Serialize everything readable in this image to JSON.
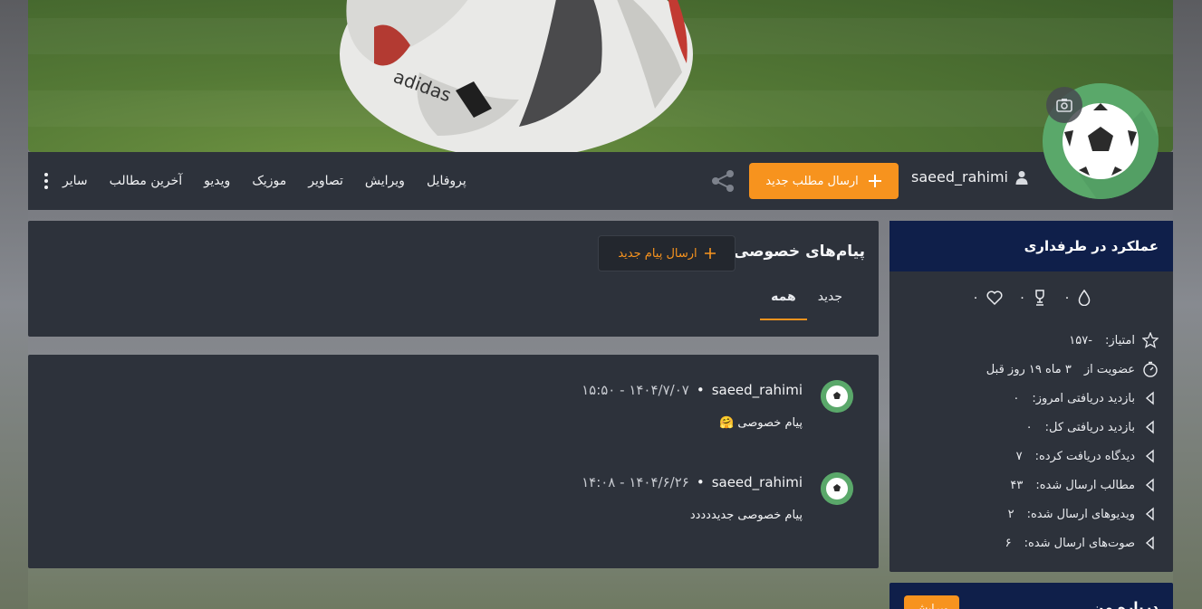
{
  "header": {
    "username": "saeed_rahimi",
    "new_post_label": "ارسال مطلب جدید",
    "menu": [
      "سایر",
      "آخرین مطالب",
      "ویدیو",
      "موزیک",
      "تصاویر",
      "ویرایش",
      "پروفایل"
    ]
  },
  "messages": {
    "title": "پیام‌های خصوصی",
    "send_label": "ارسال پیام جدید",
    "tabs": [
      {
        "label": "جدید",
        "active": false
      },
      {
        "label": "همه",
        "active": true
      }
    ],
    "items": [
      {
        "user": "saeed_rahimi",
        "time": "۱۴۰۴/۷/۰۷ - ۱۵:۵۰",
        "body": "پیام خصوصی 🤗"
      },
      {
        "user": "saeed_rahimi",
        "time": "۱۴۰۴/۶/۲۶ - ۱۴:۰۸",
        "body": "پیام خصوصی جدیددددد"
      }
    ]
  },
  "sidebar": {
    "title": "عملکرد در طرفداری",
    "badges": [
      {
        "icon": "drop-icon",
        "value": "۰"
      },
      {
        "icon": "trophy-icon",
        "value": "۰"
      },
      {
        "icon": "heart-icon",
        "value": "۰"
      }
    ],
    "stats": [
      {
        "icon": "star-icon",
        "label": "امتیاز:",
        "value": "-۱۵۷"
      },
      {
        "icon": "clock-icon",
        "label": "عضویت از",
        "value": "۳ ماه ۱۹ روز قبل"
      },
      {
        "icon": "caret-left-icon",
        "label": "بازدید دریافتی امروز:",
        "value": "۰"
      },
      {
        "icon": "caret-left-icon",
        "label": "بازدید دریافتی کل:",
        "value": "۰"
      },
      {
        "icon": "caret-left-icon",
        "label": "دیدگاه دریافت کرده:",
        "value": "۷"
      },
      {
        "icon": "caret-left-icon",
        "label": "مطالب ارسال شده:",
        "value": "۴۳"
      },
      {
        "icon": "caret-left-icon",
        "label": "ویدیوهای ارسال شده:",
        "value": "۲"
      },
      {
        "icon": "caret-left-icon",
        "label": "صوت‌های ارسال شده:",
        "value": "۶"
      }
    ],
    "about_title": "درباره من",
    "about_edit": "ویرایش"
  },
  "colors": {
    "accent": "#f7931e",
    "panel": "#2d323b",
    "sidebar_head": "#0f1f4a",
    "avatar_bg": "#5aa86a"
  }
}
